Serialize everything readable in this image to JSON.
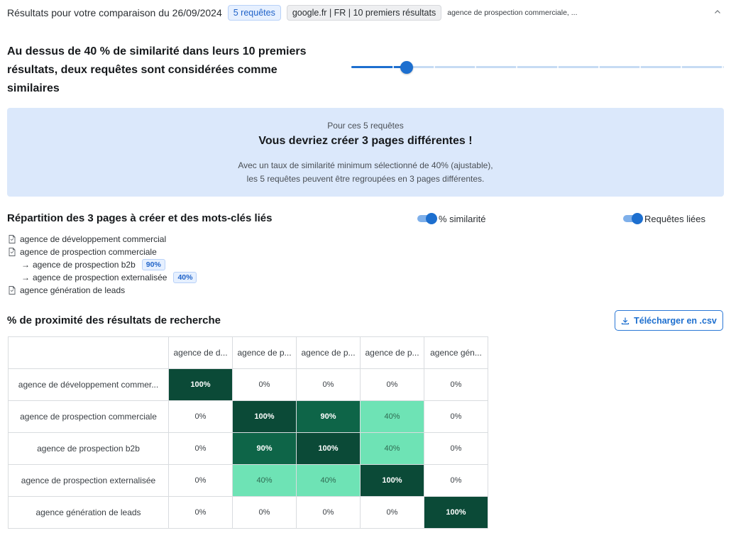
{
  "header": {
    "title": "Résultats pour votre comparaison du 26/09/2024",
    "requests_badge": "5 requêtes",
    "engine_badge": "google.fr | FR | 10 premiers résultats",
    "queries_preview": "agence de prospection commerciale, ..."
  },
  "intro": {
    "text": "Au dessus de 40 % de similarité dans leurs 10 premiers résultats, deux requêtes sont considérées comme similaires"
  },
  "slider": {
    "value_percent": 40,
    "min": 0,
    "max": 90,
    "ticks": 9
  },
  "infobox": {
    "small": "Pour ces 5 requêtes",
    "big": "Vous devriez créer 3 pages différentes !",
    "desc_line1": "Avec un taux de similarité minimum sélectionné de 40% (ajustable),",
    "desc_line2": "les 5 requêtes peuvent être regroupées en 3 pages différentes."
  },
  "repartition": {
    "title": "Répartition des 3 pages à créer et des mots-clés liés",
    "toggle_similarity": "% similarité",
    "toggle_related": "Requêtes liées",
    "items": [
      {
        "label": "agence de développement commercial",
        "sub": false,
        "badge": ""
      },
      {
        "label": "agence de prospection commerciale",
        "sub": false,
        "badge": ""
      },
      {
        "label": "agence de prospection b2b",
        "sub": true,
        "badge": "90%"
      },
      {
        "label": "agence de prospection externalisée",
        "sub": true,
        "badge": "40%"
      },
      {
        "label": "agence génération de leads",
        "sub": false,
        "badge": ""
      }
    ]
  },
  "proximity": {
    "title": "% de proximité des résultats de recherche",
    "download_label": "Télécharger en .csv",
    "columns": [
      "agence de d...",
      "agence de p...",
      "agence de p...",
      "agence de p...",
      "agence gén..."
    ],
    "rows": [
      {
        "label": "agence de développement commer...",
        "values": [
          "100%",
          "0%",
          "0%",
          "0%",
          "0%"
        ]
      },
      {
        "label": "agence de prospection commerciale",
        "values": [
          "0%",
          "100%",
          "90%",
          "40%",
          "0%"
        ]
      },
      {
        "label": "agence de prospection b2b",
        "values": [
          "0%",
          "90%",
          "100%",
          "40%",
          "0%"
        ]
      },
      {
        "label": "agence de prospection externalisée",
        "values": [
          "0%",
          "40%",
          "40%",
          "100%",
          "0%"
        ]
      },
      {
        "label": "agence génération de leads",
        "values": [
          "0%",
          "0%",
          "0%",
          "0%",
          "100%"
        ]
      }
    ],
    "colors": {
      "c100": "#0b4a37",
      "c90": "#0e6548",
      "c40": "#6ee3b5",
      "c0": "#ffffff"
    }
  }
}
